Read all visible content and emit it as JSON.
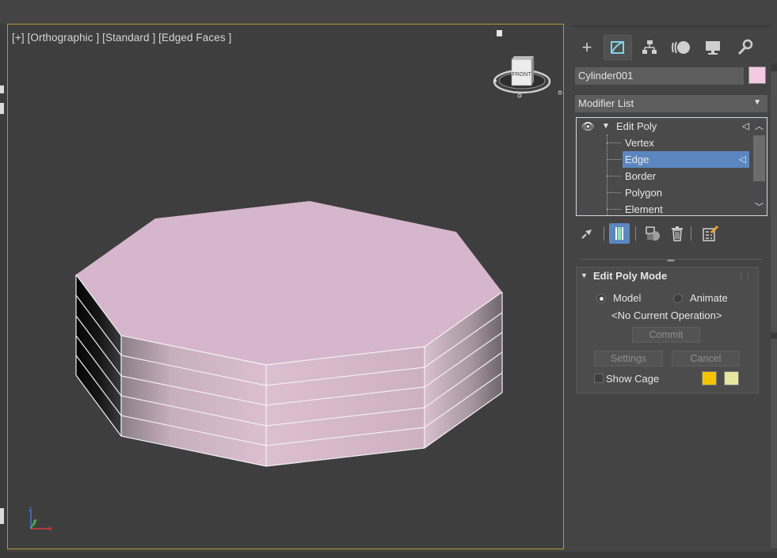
{
  "viewport": {
    "label": "[+] [Orthographic ] [Standard ] [Edged Faces ]",
    "viewcube_face": "FRONT",
    "axis_x_label": "x",
    "axis_y_label": "y",
    "axis_z_label": "z",
    "object_color": "#d6b6cc",
    "border_color": "#b8972f"
  },
  "command_panel": {
    "tabs": [
      {
        "name": "create",
        "icon": "plus-icon"
      },
      {
        "name": "modify",
        "icon": "modify-icon"
      },
      {
        "name": "hierarchy",
        "icon": "hierarchy-icon"
      },
      {
        "name": "motion",
        "icon": "motion-icon"
      },
      {
        "name": "display",
        "icon": "display-icon"
      },
      {
        "name": "utilities",
        "icon": "wrench-icon"
      }
    ],
    "active_tab": "modify",
    "object_name": "Cylinder001",
    "object_color": "#f4c9e3",
    "modifier_list_label": "Modifier List",
    "stack": {
      "modifier": "Edit Poly",
      "subobjects": [
        "Vertex",
        "Edge",
        "Border",
        "Polygon",
        "Element"
      ],
      "selected": "Edge"
    }
  },
  "edit_poly_mode": {
    "title": "Edit Poly Mode",
    "model_label": "Model",
    "animate_label": "Animate",
    "mode_selected": "Model",
    "current_operation": "<No Current Operation>",
    "commit_label": "Commit",
    "settings_label": "Settings",
    "cancel_label": "Cancel",
    "show_cage_label": "Show Cage",
    "cage_color_1": "#f5c300",
    "cage_color_2": "#e6e6a0"
  }
}
